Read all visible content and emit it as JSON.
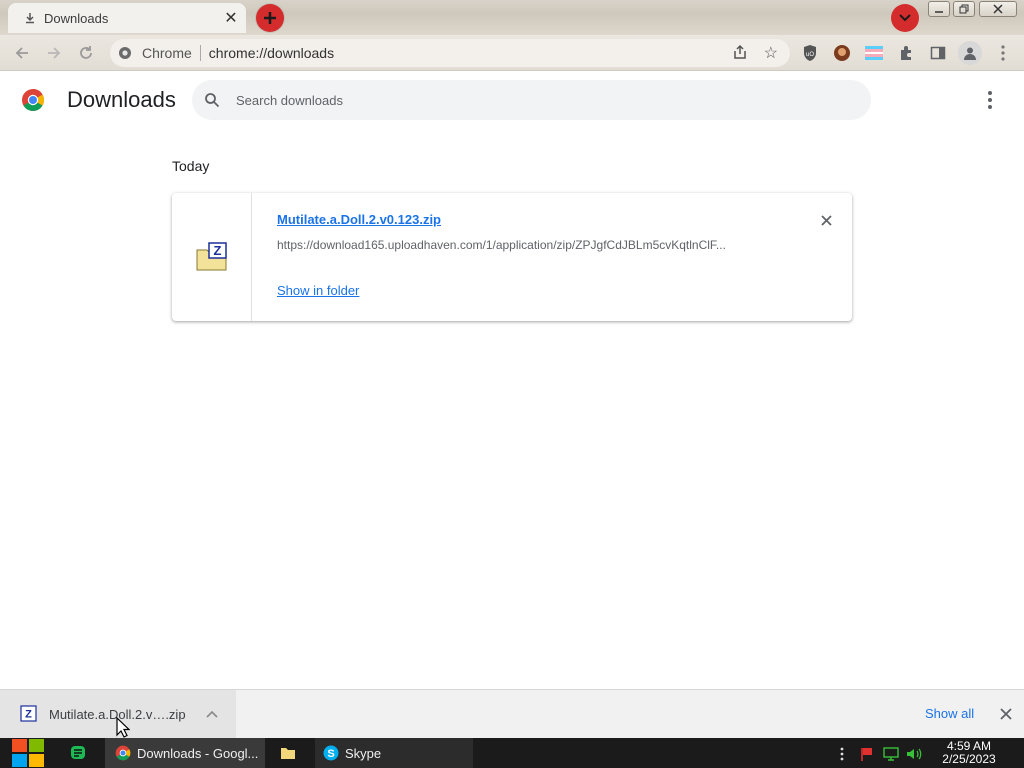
{
  "tab": {
    "title": "Downloads",
    "close_glyph": "✕"
  },
  "toolbar": {
    "site_name": "Chrome",
    "url": "chrome://downloads",
    "star_glyph": "☆"
  },
  "page": {
    "title": "Downloads",
    "search_placeholder": "Search downloads"
  },
  "downloads": {
    "date_heading": "Today",
    "items": [
      {
        "file_name": "Mutilate.a.Doll.2.v0.123.zip",
        "url": "https://download165.uploadhaven.com/1/application/zip/ZPJgfCdJBLm5cvKqtlnClF...",
        "action": "Show in folder"
      }
    ]
  },
  "shelf": {
    "item_name": "Mutilate.a.Doll.2.v….zip",
    "show_all": "Show all"
  },
  "taskbar": {
    "apps": [
      {
        "label": "Downloads - Googl..."
      },
      {
        "label": "Skype"
      }
    ],
    "time": "4:59 AM",
    "date": "2/25/2023"
  },
  "colors": {
    "accent": "#1a73e8",
    "tab_button": "#d42c2c",
    "taskbar": "#1b1b1b"
  }
}
